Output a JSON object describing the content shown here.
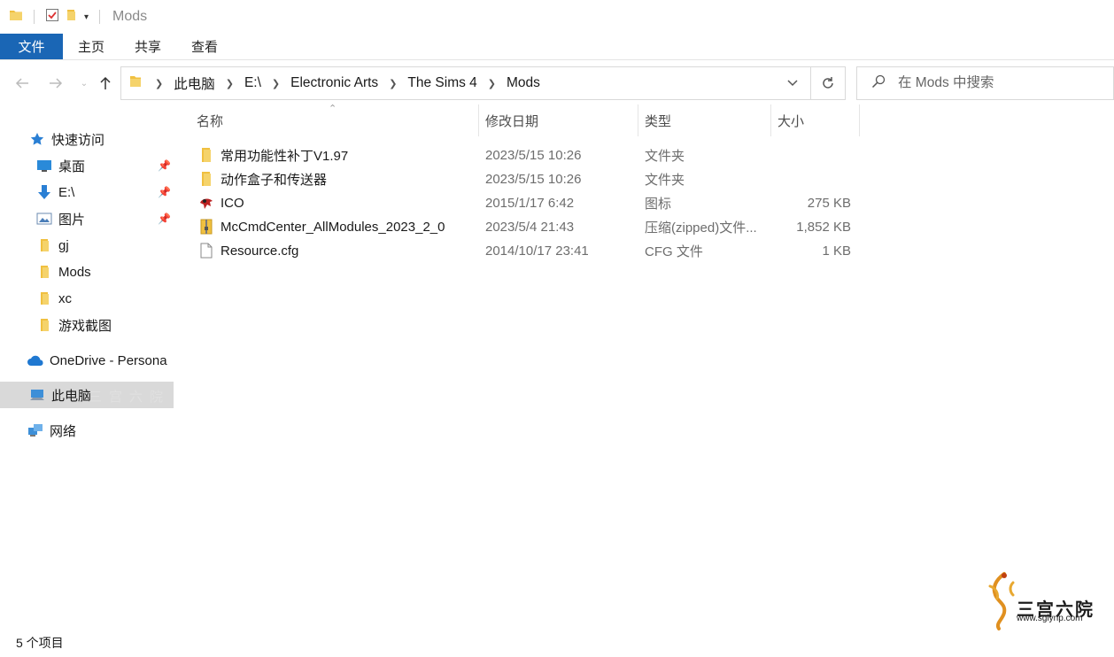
{
  "window": {
    "title": "Mods"
  },
  "ribbon": {
    "tabs": [
      {
        "label": "文件"
      },
      {
        "label": "主页"
      },
      {
        "label": "共享"
      },
      {
        "label": "查看"
      }
    ]
  },
  "address": {
    "crumbs": [
      "此电脑",
      "E:\\",
      "Electronic Arts",
      "The Sims 4",
      "Mods"
    ]
  },
  "search": {
    "placeholder": "在 Mods 中搜索"
  },
  "nav": {
    "quick_access": "快速访问",
    "items": [
      {
        "label": "桌面",
        "icon": "desktop-icon",
        "pinned": true
      },
      {
        "label": "E:\\",
        "icon": "download-arrow-icon",
        "pinned": true
      },
      {
        "label": "图片",
        "icon": "pictures-icon",
        "pinned": true
      },
      {
        "label": "gj",
        "icon": "folder-icon",
        "pinned": false
      },
      {
        "label": "Mods",
        "icon": "folder-icon",
        "pinned": false
      },
      {
        "label": "xc",
        "icon": "folder-icon",
        "pinned": false
      },
      {
        "label": "游戏截图",
        "icon": "folder-icon",
        "pinned": false
      }
    ],
    "onedrive": "OneDrive - Persona",
    "this_pc": "此电脑",
    "network": "网络"
  },
  "columns": {
    "name": "名称",
    "date": "修改日期",
    "type": "类型",
    "size": "大小"
  },
  "files": [
    {
      "name": "常用功能性补丁V1.97",
      "date": "2023/5/15 10:26",
      "type": "文件夹",
      "size": "",
      "icon": "folder-icon"
    },
    {
      "name": "动作盒子和传送器",
      "date": "2023/5/15 10:26",
      "type": "文件夹",
      "size": "",
      "icon": "folder-icon"
    },
    {
      "name": "ICO",
      "date": "2015/1/17 6:42",
      "type": "图标",
      "size": "275 KB",
      "icon": "ico-file-icon"
    },
    {
      "name": "McCmdCenter_AllModules_2023_2_0",
      "date": "2023/5/4 21:43",
      "type": "压缩(zipped)文件...",
      "size": "1,852 KB",
      "icon": "zip-file-icon"
    },
    {
      "name": "Resource.cfg",
      "date": "2014/10/17 23:41",
      "type": "CFG 文件",
      "size": "1 KB",
      "icon": "blank-file-icon"
    }
  ],
  "status": {
    "count": "5 个项目"
  },
  "watermark": {
    "text": "三宫六院",
    "url": "www.sglynp.com"
  },
  "colors": {
    "accent": "#1a66b5",
    "folder": "#f0c040",
    "selected": "#d9d9d9"
  }
}
